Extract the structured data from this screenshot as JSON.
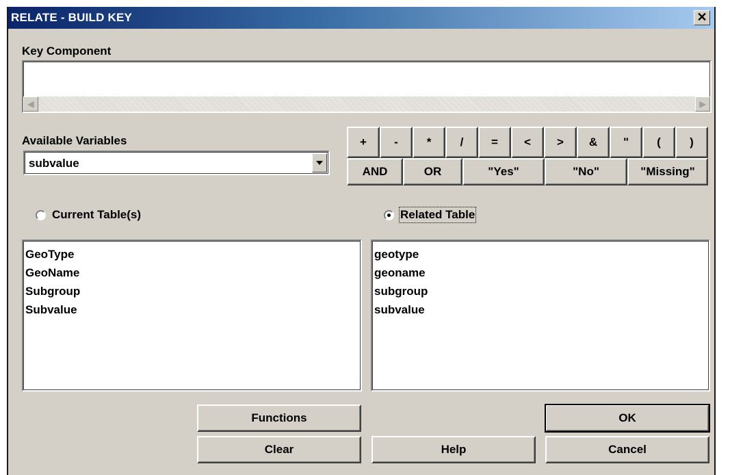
{
  "window": {
    "title": "RELATE - BUILD KEY",
    "close_label": "✕"
  },
  "key_component": {
    "label": "Key Component",
    "value": ""
  },
  "available_variables": {
    "label": "Available Variables",
    "selected": "subvalue"
  },
  "operators_row1": [
    "+",
    "-",
    "*",
    "/",
    "=",
    "<",
    ">",
    "&",
    "\"",
    "(",
    ")"
  ],
  "operators_row2": [
    "AND",
    "OR",
    "\"Yes\"",
    "\"No\"",
    "\"Missing\""
  ],
  "radios": {
    "current_label": "Current Table(s)",
    "related_label": "Related Table",
    "selected": "related"
  },
  "current_fields": [
    "GeoType",
    "GeoName",
    "Subgroup",
    "Subvalue"
  ],
  "related_fields": [
    "geotype",
    "geoname",
    "subgroup",
    "subvalue"
  ],
  "buttons": {
    "functions": "Functions",
    "ok": "OK",
    "clear": "Clear",
    "help": "Help",
    "cancel": "Cancel"
  },
  "colors": {
    "dialog_bg": "#d4d0c8",
    "title_start": "#0a246a",
    "title_end": "#a6caf0"
  },
  "icons": {
    "close": "close-icon",
    "dropdown": "chevron-down-icon",
    "scroll_left": "arrow-left-icon",
    "scroll_right": "arrow-right-icon"
  }
}
